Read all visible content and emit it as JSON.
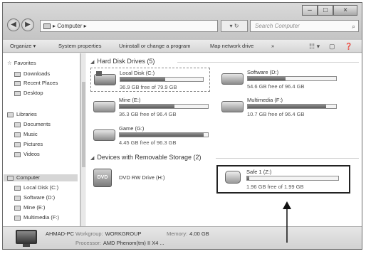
{
  "titlebar": {
    "window_buttons": [
      "–",
      "□",
      "×"
    ],
    "back_icon": "◀",
    "forward_icon": "▶",
    "address": "▸ Computer ▸",
    "refresh": "▾ ↻",
    "search_placeholder": "Search Computer",
    "search_icon": "⌕"
  },
  "toolbar": {
    "organize": "Organize ▾",
    "system_properties": "System properties",
    "uninstall": "Uninstall or change a program",
    "map_drive": "Map network drive",
    "more": "»",
    "view_icon": "☷ ▾",
    "pane_icon": "▢",
    "help_icon": "❓"
  },
  "sidebar": {
    "favorites": "Favorites",
    "downloads": "Downloads",
    "recent_places": "Recent Places",
    "desktop": "Desktop",
    "libraries": "Libraries",
    "documents": "Documents",
    "music": "Music",
    "pictures": "Pictures",
    "videos": "Videos",
    "computer": "Computer",
    "local_disk": "Local Disk (C:)",
    "software": "Software (D:)",
    "mine": "Mine (E:)",
    "multimedia": "Multimedia (F:)"
  },
  "groups": {
    "hard_disks": "Hard Disk Drives (5)",
    "removable": "Devices with Removable Storage (2)",
    "collapse_icon": "◢"
  },
  "drives": [
    {
      "name": "Local Disk (C:)",
      "free": "36.9 GB free of 79.9 GB",
      "used_fraction": 0.54
    },
    {
      "name": "Software (D:)",
      "free": "54.6 GB free of 96.4 GB",
      "used_fraction": 0.43
    },
    {
      "name": "Mine (E:)",
      "free": "36.3 GB free of 96.4 GB",
      "used_fraction": 0.62
    },
    {
      "name": "Multimedia (F:)",
      "free": "10.7 GB free of 96.4 GB",
      "used_fraction": 0.89
    },
    {
      "name": "Game (G:)",
      "free": "4.45 GB free of 96.3 GB",
      "used_fraction": 0.95
    }
  ],
  "removable": [
    {
      "name": "DVD RW Drive (H:)",
      "icon": "DVD"
    },
    {
      "name": "Safe 1 (Z:)",
      "free": "1.96 GB free of 1.99 GB",
      "used_fraction": 0.02
    }
  ],
  "status": {
    "pc_name": "AHMAD-PC",
    "workgroup_label": "Workgroup:",
    "workgroup": "WORKGROUP",
    "memory_label": "Memory:",
    "memory": "4.00 GB",
    "processor_label": "Processor:",
    "processor": "AMD Phenom(tm) II X4 ..."
  }
}
